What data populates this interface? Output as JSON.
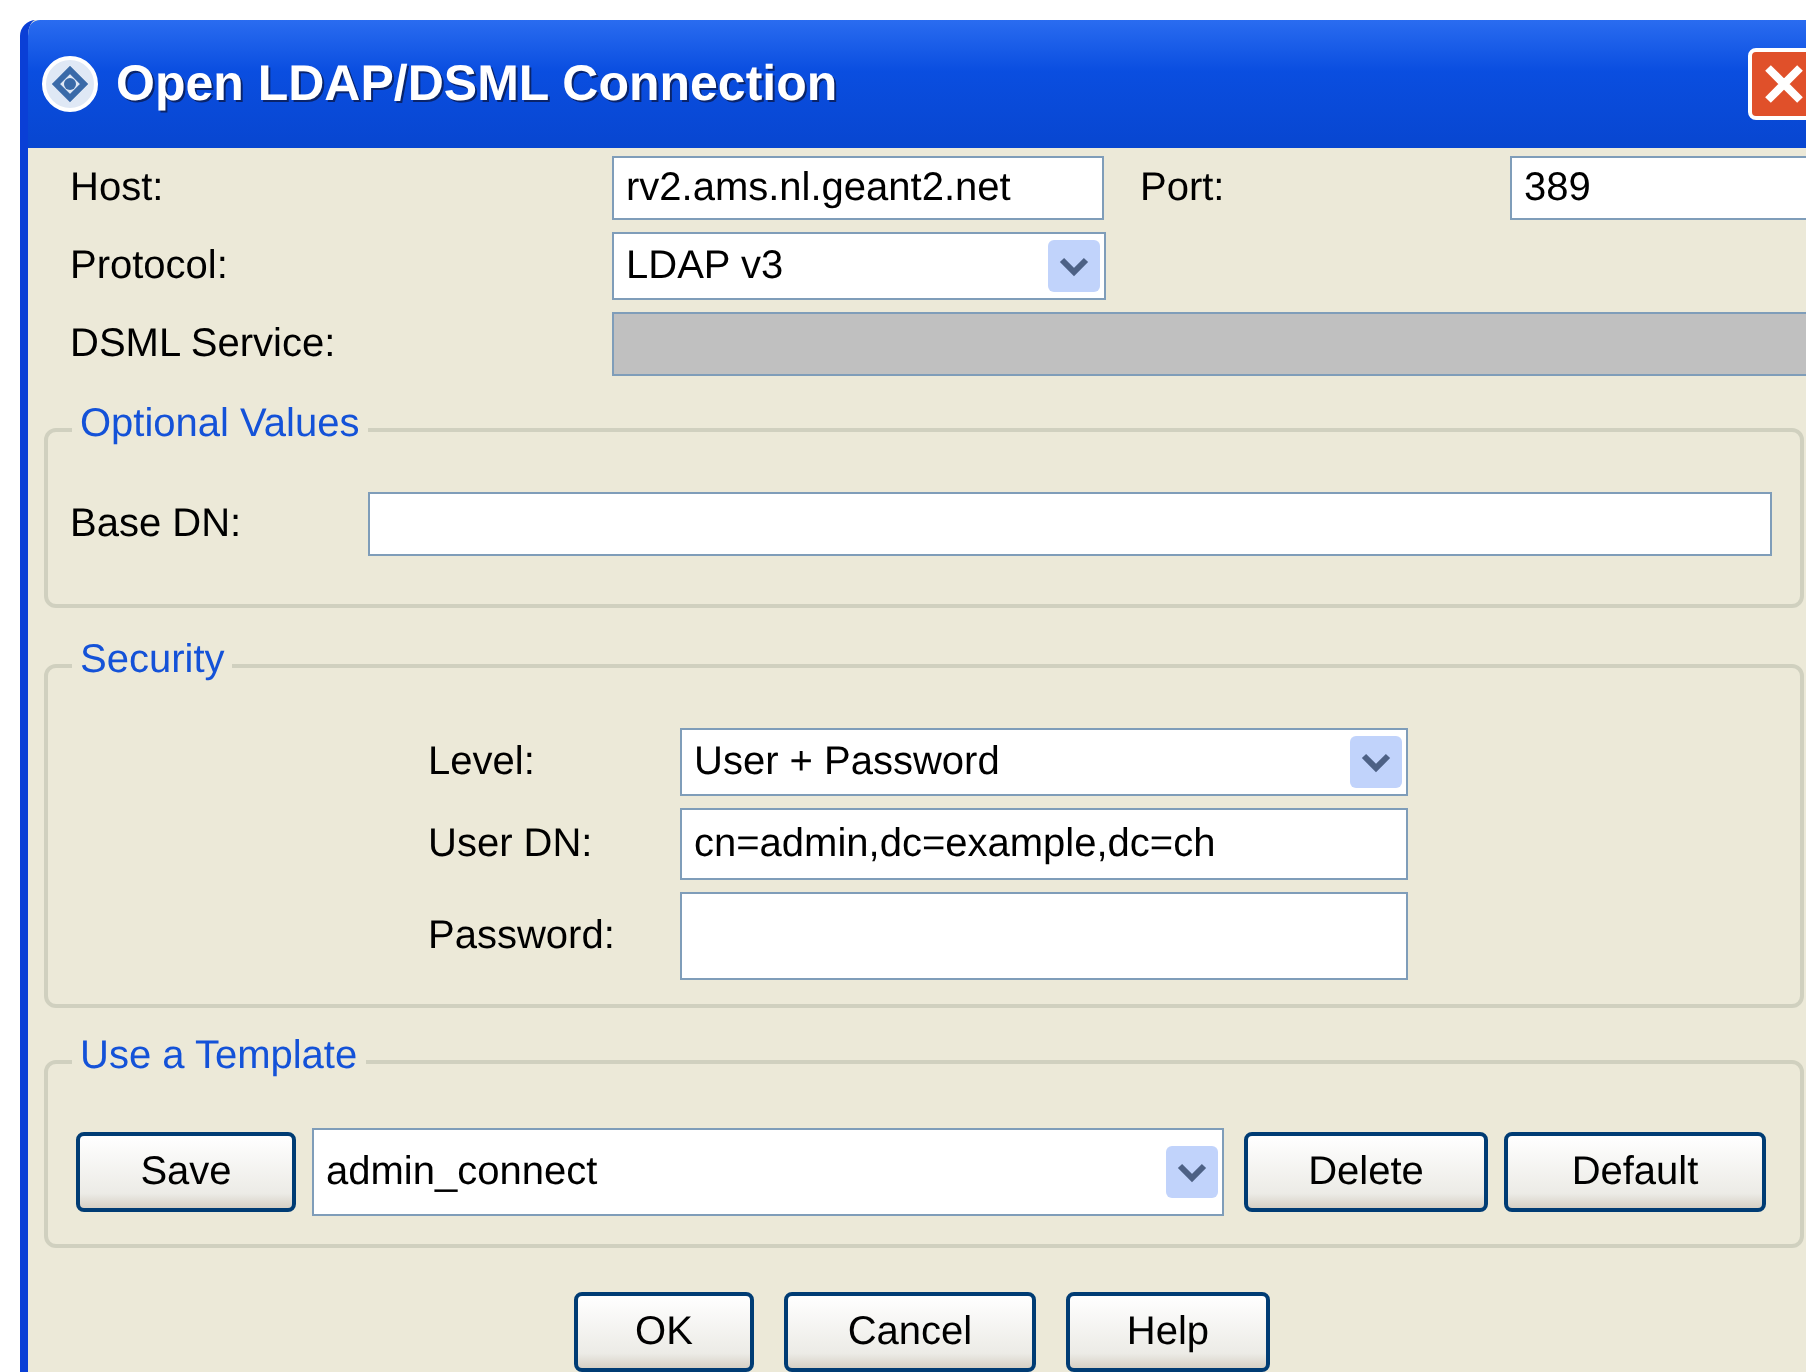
{
  "window": {
    "title": "Open LDAP/DSML Connection"
  },
  "connection": {
    "host": {
      "label": "Host:",
      "value": "rv2.ams.nl.geant2.net"
    },
    "port": {
      "label": "Port:",
      "value": "389"
    },
    "protocol": {
      "label": "Protocol:",
      "value": "LDAP v3"
    },
    "dsml_service": {
      "label": "DSML Service:",
      "disabled": true
    }
  },
  "optional_values": {
    "title": "Optional Values",
    "base_dn": {
      "label": "Base DN:"
    }
  },
  "security": {
    "title": "Security",
    "level": {
      "label": "Level:",
      "value": "User + Password"
    },
    "user_dn": {
      "label": "User DN:",
      "value": "cn=admin,dc=example,dc=ch"
    },
    "password": {
      "label": "Password:"
    }
  },
  "template": {
    "title": "Use a Template",
    "save": "Save",
    "value": "admin_connect",
    "delete": "Delete",
    "default": "Default"
  },
  "buttons": [
    "OK",
    "Cancel",
    "Help"
  ]
}
